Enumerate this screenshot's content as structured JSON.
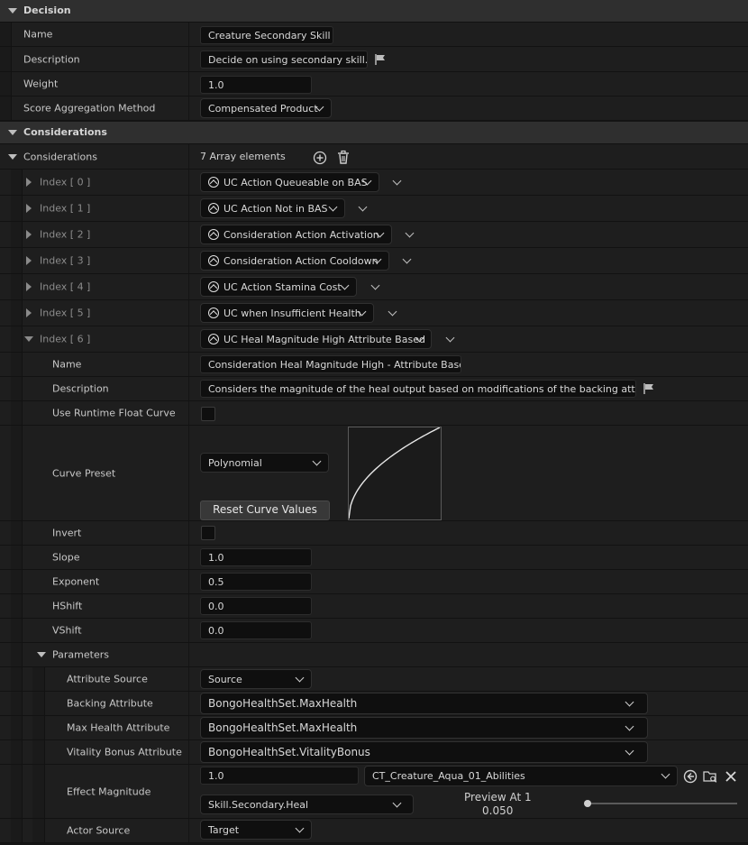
{
  "decision": {
    "header": "Decision",
    "name_label": "Name",
    "name_value": "Creature Secondary Skill",
    "description_label": "Description",
    "description_value": "Decide on using secondary skill.",
    "weight_label": "Weight",
    "weight_value": "1.0",
    "score_label": "Score Aggregation Method",
    "score_value": "Compensated Product"
  },
  "considerations": {
    "header": "Considerations",
    "array_label": "Considerations",
    "array_count": "7 Array elements",
    "items": [
      {
        "index": "Index [ 0 ]",
        "value": "UC Action Queueable on BAS"
      },
      {
        "index": "Index [ 1 ]",
        "value": "UC Action Not in BAS"
      },
      {
        "index": "Index [ 2 ]",
        "value": "Consideration Action Activation"
      },
      {
        "index": "Index [ 3 ]",
        "value": "Consideration Action Cooldown"
      },
      {
        "index": "Index [ 4 ]",
        "value": "UC Action Stamina Cost"
      },
      {
        "index": "Index [ 5 ]",
        "value": "UC when Insufficient Health"
      },
      {
        "index": "Index [ 6 ]",
        "value": "UC Heal Magnitude High Attribute Based"
      }
    ]
  },
  "detail": {
    "name_label": "Name",
    "name_value": "Consideration Heal Magnitude High - Attribute Based",
    "description_label": "Description",
    "description_value": "Considers the magnitude of the heal output based on modifications of the backing attribute.",
    "runtime_label": "Use Runtime Float Curve",
    "curve_label": "Curve Preset",
    "curve_value": "Polynomial",
    "reset_label": "Reset Curve Values",
    "invert_label": "Invert",
    "slope_label": "Slope",
    "slope_value": "1.0",
    "exponent_label": "Exponent",
    "exponent_value": "0.5",
    "hshift_label": "HShift",
    "hshift_value": "0.0",
    "vshift_label": "VShift",
    "vshift_value": "0.0",
    "parameters_label": "Parameters"
  },
  "params": {
    "attr_source_label": "Attribute Source",
    "attr_source_value": "Source",
    "backing_label": "Backing Attribute",
    "backing_value": "BongoHealthSet.MaxHealth",
    "maxhealth_label": "Max Health Attribute",
    "maxhealth_value": "BongoHealthSet.MaxHealth",
    "vitality_label": "Vitality Bonus Attribute",
    "vitality_value": "BongoHealthSet.VitalityBonus",
    "effect_label": "Effect Magnitude",
    "effect_value": "1.0",
    "effect_table": "CT_Creature_Aqua_01_Abilities",
    "effect_row": "Skill.Secondary.Heal",
    "preview_label": "Preview At 1",
    "preview_value": "0.050",
    "preview_slider": 0.0,
    "actor_label": "Actor Source",
    "actor_value": "Target"
  },
  "curve_preview": {
    "exponent": 0.5,
    "slope": 1.0
  }
}
